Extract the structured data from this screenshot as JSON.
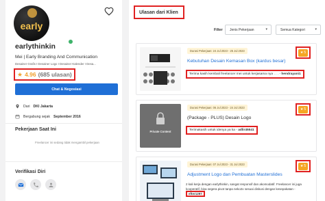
{
  "profile": {
    "avatar_text": "early",
    "username": "earlythinkin",
    "tagline": "Mei | Early Branding And Communication",
    "skills": "Desainer Grafis I Desainer Logo I Desainer Kalender I Desa...",
    "rating_value": "4.96",
    "rating_count": "(685 ulasan)",
    "chat_button": "Chat & Negosiasi",
    "location_prefix": "Dari",
    "location": "DKI Jakarta",
    "joined_prefix": "Bergabung sejak",
    "joined": "September 2016",
    "current_jobs_title": "Pekerjaan Saat Ini",
    "current_jobs_empty": "Freelancer ini sedang tidak mengambil pekerjaan",
    "verification_title": "Verifikasi Diri"
  },
  "reviews": {
    "title": "Ulasan dari Klien",
    "filter_label": "Filter",
    "filter_job": "Jenis Pekerjaan",
    "filter_category": "Semua Kategori",
    "items": [
      {
        "date": "Durasi Pekerjaan: 24 Jul 2023 - 25 Jul 2023",
        "title": "Kebutuhan Desain Kemasan Box (kardus besar)",
        "comment": "Terima kasih kembali freelancer mei untuk kerjasama nya . . .",
        "author": "hendrayani1",
        "rating": "5"
      },
      {
        "date": "Durasi Pekerjaan: 06 Jul 2023 - 24 Jul 2023",
        "title": "(Package - PLUS) Desain Logo",
        "thumb_label": "Private Content",
        "comment": "Terimakasih untuk idenya ya ka -",
        "author": "adlir45541",
        "rating": "5"
      },
      {
        "date": "Durasi Pekerjaan: 07 Jul 2023 - 31 Jul 2023",
        "title": "Adjustment Logo dan Pembuatan Masterslides",
        "comment": "2 kali kerja dengan earlythinkin, sangat responsif dan akomodatif. Freelancer ini juga kooperatif, bisa segera pivot tanpa neko2x sesuai diskusi dengan kesepakatan -",
        "author": "efter1297",
        "rating": "5"
      }
    ]
  },
  "colors": {
    "accent_blue": "#1f6fd6",
    "star_orange": "#f0a12d",
    "highlight_red": "#e02020",
    "date_chip_bg": "#fff4d6"
  },
  "icons": [
    "heart-icon",
    "verified-badge-icon",
    "star-icon",
    "location-pin-icon",
    "calendar-icon",
    "chevron-down-icon",
    "mail-icon",
    "phone-icon",
    "user-id-icon"
  ]
}
